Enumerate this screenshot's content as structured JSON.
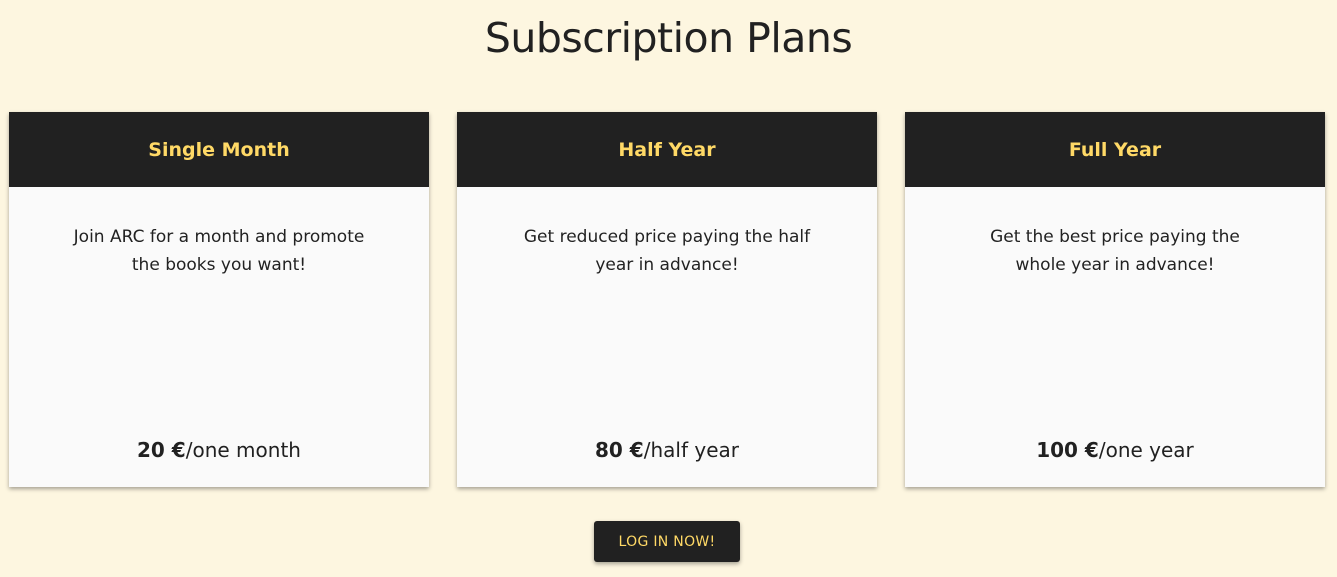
{
  "page": {
    "title": "Subscription Plans"
  },
  "plans": [
    {
      "name": "Single Month",
      "description": "Join ARC for a month and promote the books you want!",
      "price": "20 €",
      "period": "/one month"
    },
    {
      "name": "Half Year",
      "description": "Get reduced price paying the half year in advance!",
      "price": "80 €",
      "period": "/half year"
    },
    {
      "name": "Full Year",
      "description": "Get the best price paying the whole year in advance!",
      "price": "100 €",
      "period": "/one year"
    }
  ],
  "login_button": "LOG IN NOW!",
  "colors": {
    "background": "#fdf6e0",
    "header": "#212121",
    "accent": "#ffd966"
  }
}
